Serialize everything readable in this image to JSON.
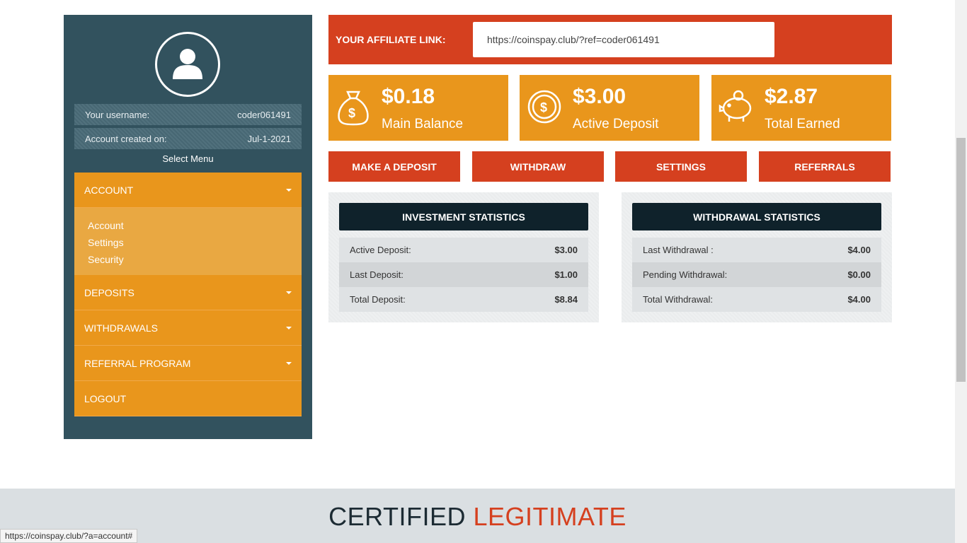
{
  "sidebar": {
    "username_label": "Your username:",
    "username": "coder061491",
    "created_label": "Account created on:",
    "created": "Jul-1-2021",
    "select_menu": "Select Menu",
    "menu": {
      "account": "ACCOUNT",
      "sub": [
        "Account",
        "Settings",
        "Security"
      ],
      "deposits": "DEPOSITS",
      "withdrawals": "WITHDRAWALS",
      "referral": "REFERRAL PROGRAM",
      "logout": "LOGOUT"
    }
  },
  "affiliate": {
    "label": "YOUR AFFILIATE LINK:",
    "url": "https://coinspay.club/?ref=coder061491"
  },
  "cards": [
    {
      "amount": "$0.18",
      "label": "Main Balance",
      "icon": "money-bag-icon"
    },
    {
      "amount": "$3.00",
      "label": "Active Deposit",
      "icon": "coin-icon"
    },
    {
      "amount": "$2.87",
      "label": "Total Earned",
      "icon": "piggy-bank-icon"
    }
  ],
  "buttons": {
    "deposit": "MAKE A DEPOSIT",
    "withdraw": "WITHDRAW",
    "settings": "SETTINGS",
    "referrals": "REFERRALS"
  },
  "investment": {
    "title": "INVESTMENT STATISTICS",
    "rows": [
      {
        "label": "Active Deposit:",
        "value": "$3.00"
      },
      {
        "label": "Last Deposit:",
        "value": "$1.00"
      },
      {
        "label": "Total Deposit:",
        "value": "$8.84"
      }
    ]
  },
  "withdrawal": {
    "title": "WITHDRAWAL STATISTICS",
    "rows": [
      {
        "label": "Last Withdrawal :",
        "value": "$4.00"
      },
      {
        "label": "Pending Withdrawal:",
        "value": "$0.00"
      },
      {
        "label": "Total Withdrawal:",
        "value": "$4.00"
      }
    ]
  },
  "footer": {
    "cert_word1": "CERTIFIED",
    "cert_word2": "LEGITIMATE"
  },
  "status_bar_url": "https://coinspay.club/?a=account#",
  "colors": {
    "sidebar": "#32525e",
    "orange": "#e9961c",
    "red": "#d5401f",
    "dark_header": "#0f222b"
  }
}
